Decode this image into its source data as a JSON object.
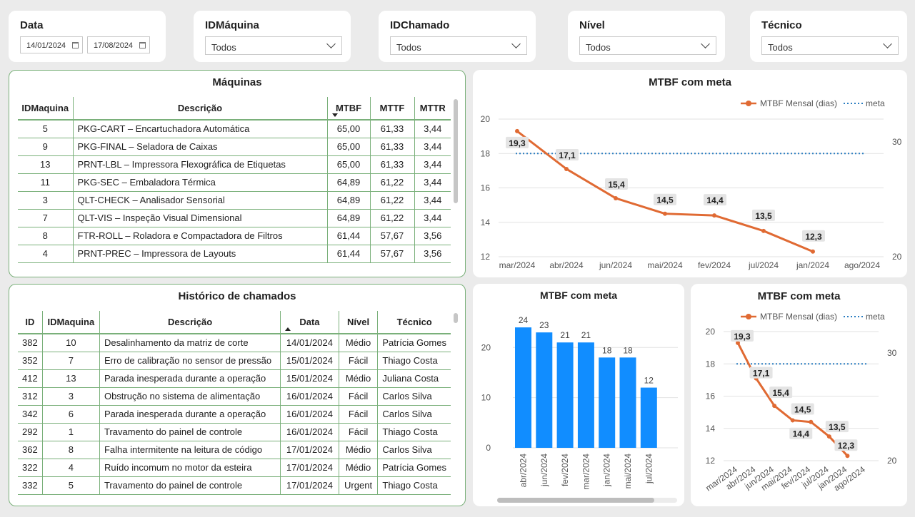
{
  "slicers": {
    "date": {
      "title": "Data",
      "start": "14/01/2024",
      "end": "17/08/2024"
    },
    "maquina": {
      "title": "IDMáquina",
      "value": "Todos"
    },
    "chamado": {
      "title": "IDChamado",
      "value": "Todos"
    },
    "nivel": {
      "title": "Nível",
      "value": "Todos"
    },
    "tecnico": {
      "title": "Técnico",
      "value": "Todos"
    }
  },
  "maquinas": {
    "title": "Máquinas",
    "columns": [
      "IDMaquina",
      "Descrição",
      "MTBF",
      "MTTF",
      "MTTR"
    ],
    "rows": [
      [
        "5",
        "PKG-CART – Encartuchadora Automática",
        "65,00",
        "61,33",
        "3,44"
      ],
      [
        "9",
        "PKG-FINAL – Seladora de Caixas",
        "65,00",
        "61,33",
        "3,44"
      ],
      [
        "13",
        "PRNT-LBL – Impressora Flexográfica de Etiquetas",
        "65,00",
        "61,33",
        "3,44"
      ],
      [
        "11",
        "PKG-SEC – Embaladora Térmica",
        "64,89",
        "61,22",
        "3,44"
      ],
      [
        "3",
        "QLT-CHECK – Analisador Sensorial",
        "64,89",
        "61,22",
        "3,44"
      ],
      [
        "7",
        "QLT-VIS – Inspeção Visual Dimensional",
        "64,89",
        "61,22",
        "3,44"
      ],
      [
        "8",
        "FTR-ROLL – Roladora e Compactadora de Filtros",
        "61,44",
        "57,67",
        "3,56"
      ],
      [
        "4",
        "PRNT-PREC – Impressora de Layouts",
        "61,44",
        "57,67",
        "3,56"
      ]
    ]
  },
  "historico": {
    "title": "Histórico de chamados",
    "columns": [
      "ID",
      "IDMaquina",
      "Descrição",
      "Data",
      "Nível",
      "Técnico"
    ],
    "rows": [
      [
        "382",
        "10",
        "Desalinhamento da matriz de corte",
        "14/01/2024",
        "Médio",
        "Patrícia Gomes"
      ],
      [
        "352",
        "7",
        "Erro de calibração no sensor de pressão",
        "15/01/2024",
        "Fácil",
        "Thiago Costa"
      ],
      [
        "412",
        "13",
        "Parada inesperada durante a operação",
        "15/01/2024",
        "Médio",
        "Juliana Costa"
      ],
      [
        "312",
        "3",
        "Obstrução no sistema de alimentação",
        "16/01/2024",
        "Fácil",
        "Carlos Silva"
      ],
      [
        "342",
        "6",
        "Parada inesperada durante a operação",
        "16/01/2024",
        "Fácil",
        "Carlos Silva"
      ],
      [
        "292",
        "1",
        "Travamento do painel de controle",
        "16/01/2024",
        "Fácil",
        "Thiago Costa"
      ],
      [
        "362",
        "8",
        "Falha intermitente na leitura de código",
        "17/01/2024",
        "Médio",
        "Carlos Silva"
      ],
      [
        "322",
        "4",
        "Ruído incomum no motor da esteira",
        "17/01/2024",
        "Médio",
        "Patrícia Gomes"
      ],
      [
        "332",
        "5",
        "Travamento do painel de controle",
        "17/01/2024",
        "Urgent",
        "Thiago Costa"
      ]
    ]
  },
  "chart_data": [
    {
      "type": "line",
      "title": "MTBF com meta",
      "x": [
        "mar/2024",
        "abr/2024",
        "jun/2024",
        "mai/2024",
        "fev/2024",
        "jul/2024",
        "jan/2024",
        "ago/2024"
      ],
      "series": [
        {
          "name": "MTBF Mensal (dias)",
          "values": [
            19.3,
            17.1,
            15.4,
            14.5,
            14.4,
            13.5,
            12.3,
            null
          ],
          "labels": [
            "19,3",
            "17,1",
            "15,4",
            "14,5",
            "14,4",
            "13,5",
            "12,3",
            ""
          ]
        },
        {
          "name": "meta",
          "values": [
            29.0,
            29.0,
            29.0,
            29.0,
            29.0,
            29.0,
            29.0,
            29.0
          ],
          "axis": "secondary"
        }
      ],
      "ylim": [
        12,
        20
      ],
      "yticks": [
        "12",
        "14",
        "16",
        "18",
        "20"
      ],
      "y2lim": [
        20,
        32
      ],
      "y2ticks": [
        "20",
        "30"
      ],
      "legend": "top-right",
      "grid": true,
      "colors": {
        "line": "#e06a33",
        "meta": "#2a7dc1"
      }
    },
    {
      "type": "bar",
      "title": "MTBF com meta",
      "categories": [
        "abr/2024",
        "jun/2024",
        "fev/2024",
        "mar/2024",
        "jan/2024",
        "mai/2024",
        "jul/2024"
      ],
      "values": [
        24,
        23,
        21,
        21,
        18,
        18,
        12
      ],
      "ylim": [
        0,
        27
      ],
      "yticks": [
        "0",
        "10",
        "20"
      ],
      "grid": true,
      "colors": {
        "bar": "#118dff"
      }
    },
    {
      "type": "line",
      "title": "MTBF com meta",
      "x": [
        "mar/2024",
        "abr/2024",
        "jun/2024",
        "mai/2024",
        "fev/2024",
        "jul/2024",
        "jan/2024",
        "ago/2024"
      ],
      "series": [
        {
          "name": "MTBF Mensal (dias)",
          "values": [
            19.3,
            17.1,
            15.4,
            14.5,
            14.4,
            13.5,
            12.3,
            null
          ],
          "labels": [
            "19,3",
            "17,1",
            "15,4",
            "14,5",
            "14,4",
            "13,5",
            "12,3",
            ""
          ]
        },
        {
          "name": "meta",
          "values": [
            29.0,
            29.0,
            29.0,
            29.0,
            29.0,
            29.0,
            29.0,
            29.0
          ],
          "axis": "secondary"
        }
      ],
      "ylim": [
        12,
        20
      ],
      "yticks": [
        "12",
        "14",
        "16",
        "18",
        "20"
      ],
      "y2lim": [
        20,
        32
      ],
      "y2ticks": [
        "20",
        "30"
      ],
      "legend": "top-right",
      "grid": true,
      "colors": {
        "line": "#e06a33",
        "meta": "#2a7dc1"
      }
    }
  ]
}
